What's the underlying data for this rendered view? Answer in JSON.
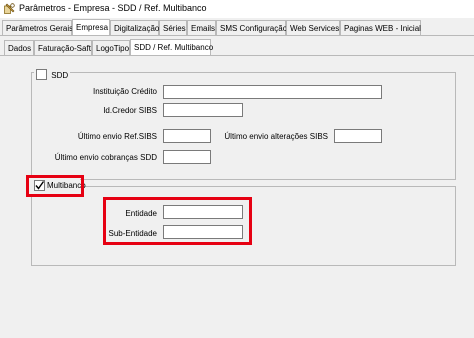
{
  "window": {
    "title": "Parâmetros - Empresa - SDD / Ref. Multibanco",
    "icon": "settings-app-icon"
  },
  "main_tabs": [
    {
      "label": "Parâmetros Gerais"
    },
    {
      "label": "Empresa"
    },
    {
      "label": "Digitalização"
    },
    {
      "label": "Séries"
    },
    {
      "label": "Emails"
    },
    {
      "label": "SMS Configuração"
    },
    {
      "label": "Web Services"
    },
    {
      "label": "Paginas WEB - Inicial"
    }
  ],
  "sub_tabs": [
    {
      "label": "Dados"
    },
    {
      "label": "Faturação-Saft"
    },
    {
      "label": "LogoTipo"
    },
    {
      "label": "SDD / Ref. Multibanco"
    }
  ],
  "sdd": {
    "checkbox_label": "SDD",
    "checked": false,
    "fields": {
      "instituicao_credito": {
        "label": "Instituição Crédito",
        "value": ""
      },
      "id_credor": {
        "label": "Id.Credor SIBS",
        "value": ""
      },
      "ultimo_envio_ref": {
        "label": "Último envio Ref.SIBS",
        "value": ""
      },
      "ultimo_envio_alteracoes": {
        "label": "Último envio alterações SIBS",
        "value": ""
      },
      "ultimo_envio_cobrancas": {
        "label": "Último envio cobranças SDD",
        "value": ""
      }
    }
  },
  "multibanco": {
    "checkbox_label": "Multibanco",
    "checked": true,
    "fields": {
      "entidade": {
        "label": "Entidade",
        "value": ""
      },
      "sub_entidade": {
        "label": "Sub-Entidade",
        "value": ""
      }
    }
  },
  "colors": {
    "highlight": "#e60012",
    "window_bg": "#f0f0f0"
  }
}
